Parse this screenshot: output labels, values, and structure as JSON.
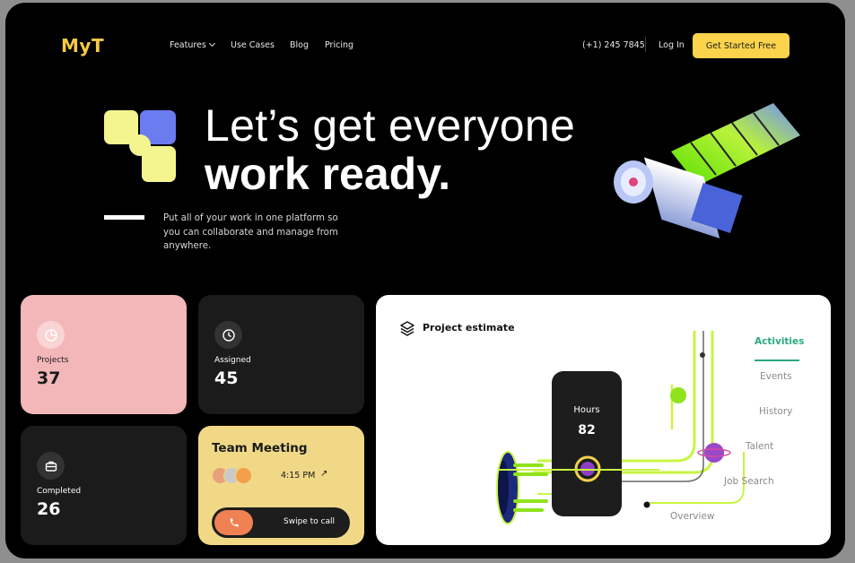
{
  "brand": {
    "logo_text": "MyT",
    "accent": "#fcd44c"
  },
  "nav": {
    "items": [
      {
        "label": "Features",
        "has_dropdown": true
      },
      {
        "label": "Use Cases"
      },
      {
        "label": "Blog"
      },
      {
        "label": "Pricing"
      }
    ],
    "phone": "(+1) 245 7845",
    "login": "Log In",
    "cta": "Get Started Free"
  },
  "hero": {
    "title_line1": "Let’s get everyone",
    "title_line2": "work ready.",
    "subtitle": "Put all of your work in one platform so you can collaborate and manage from anywhere."
  },
  "stats": [
    {
      "label": "Projects",
      "value": "37",
      "icon": "pie-chart-icon"
    },
    {
      "label": "Assigned",
      "value": "45",
      "icon": "clock-icon"
    },
    {
      "label": "Completed",
      "value": "26",
      "icon": "briefcase-icon"
    }
  ],
  "meeting": {
    "title": "Team Meeting",
    "time": "4:15 PM",
    "swipe_label": "Swipe to call"
  },
  "estimate": {
    "title": "Project estimate",
    "hours_label": "Hours",
    "hours_value": "82",
    "menu": [
      "Activities",
      "Events",
      "History",
      "Talent",
      "Job Search",
      "Overview"
    ],
    "active_item": "Activities",
    "colors": {
      "active": "#2ba97f",
      "lime": "#c8f542",
      "purple": "#9a47c8"
    }
  }
}
